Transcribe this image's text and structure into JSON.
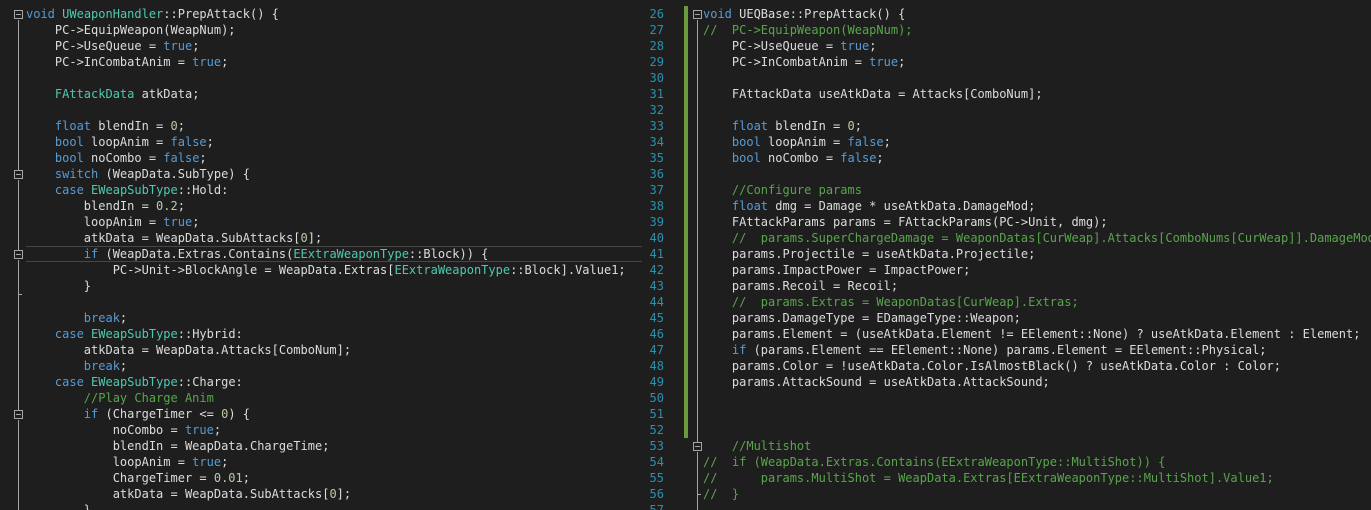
{
  "left_editor": {
    "lines": [
      {
        "segments": [
          {
            "text": "void",
            "cls": "k"
          },
          {
            "text": " "
          },
          {
            "text": "UWeaponHandler",
            "cls": "t"
          },
          {
            "text": "::PrepAttack() {"
          }
        ]
      },
      {
        "segments": [
          {
            "text": "    PC->EquipWeapon(WeapNum);"
          }
        ]
      },
      {
        "segments": [
          {
            "text": "    PC->UseQueue = "
          },
          {
            "text": "true",
            "cls": "k"
          },
          {
            "text": ";"
          }
        ]
      },
      {
        "segments": [
          {
            "text": "    PC->InCombatAnim = "
          },
          {
            "text": "true",
            "cls": "k"
          },
          {
            "text": ";"
          }
        ]
      },
      {
        "segments": []
      },
      {
        "segments": [
          {
            "text": "    "
          },
          {
            "text": "FAttackData",
            "cls": "t"
          },
          {
            "text": " atkData;"
          }
        ]
      },
      {
        "segments": []
      },
      {
        "segments": [
          {
            "text": "    "
          },
          {
            "text": "float",
            "cls": "k"
          },
          {
            "text": " blendIn = "
          },
          {
            "text": "0",
            "cls": "n"
          },
          {
            "text": ";"
          }
        ]
      },
      {
        "segments": [
          {
            "text": "    "
          },
          {
            "text": "bool",
            "cls": "k"
          },
          {
            "text": " loopAnim = "
          },
          {
            "text": "false",
            "cls": "k"
          },
          {
            "text": ";"
          }
        ]
      },
      {
        "segments": [
          {
            "text": "    "
          },
          {
            "text": "bool",
            "cls": "k"
          },
          {
            "text": " noCombo = "
          },
          {
            "text": "false",
            "cls": "k"
          },
          {
            "text": ";"
          }
        ]
      },
      {
        "segments": [
          {
            "text": "    "
          },
          {
            "text": "switch",
            "cls": "k"
          },
          {
            "text": " (WeapData.SubType) {"
          }
        ]
      },
      {
        "segments": [
          {
            "text": "    "
          },
          {
            "text": "case",
            "cls": "k"
          },
          {
            "text": " "
          },
          {
            "text": "EWeapSubType",
            "cls": "t"
          },
          {
            "text": "::Hold:"
          }
        ]
      },
      {
        "segments": [
          {
            "text": "        blendIn = "
          },
          {
            "text": "0.2",
            "cls": "n"
          },
          {
            "text": ";"
          }
        ]
      },
      {
        "segments": [
          {
            "text": "        loopAnim = "
          },
          {
            "text": "true",
            "cls": "k"
          },
          {
            "text": ";"
          }
        ]
      },
      {
        "segments": [
          {
            "text": "        atkData = WeapData.SubAttacks["
          },
          {
            "text": "0",
            "cls": "n"
          },
          {
            "text": "];"
          }
        ]
      },
      {
        "segments": [
          {
            "text": "        "
          },
          {
            "text": "if",
            "cls": "k"
          },
          {
            "text": " (WeapData.Extras.Contains("
          },
          {
            "text": "EExtraWeaponType",
            "cls": "t"
          },
          {
            "text": "::Block)) {"
          }
        ]
      },
      {
        "segments": [
          {
            "text": "            PC->Unit->BlockAngle = WeapData.Extras["
          },
          {
            "text": "EExtraWeaponType",
            "cls": "t"
          },
          {
            "text": "::Block].Value1;"
          }
        ]
      },
      {
        "segments": [
          {
            "text": "        }"
          }
        ]
      },
      {
        "segments": []
      },
      {
        "segments": [
          {
            "text": "        "
          },
          {
            "text": "break",
            "cls": "k"
          },
          {
            "text": ";"
          }
        ]
      },
      {
        "segments": [
          {
            "text": "    "
          },
          {
            "text": "case",
            "cls": "k"
          },
          {
            "text": " "
          },
          {
            "text": "EWeapSubType",
            "cls": "t"
          },
          {
            "text": "::Hybrid:"
          }
        ]
      },
      {
        "segments": [
          {
            "text": "        atkData = WeapData.Attacks[ComboNum];"
          }
        ]
      },
      {
        "segments": [
          {
            "text": "        "
          },
          {
            "text": "break",
            "cls": "k"
          },
          {
            "text": ";"
          }
        ]
      },
      {
        "segments": [
          {
            "text": "    "
          },
          {
            "text": "case",
            "cls": "k"
          },
          {
            "text": " "
          },
          {
            "text": "EWeapSubType",
            "cls": "t"
          },
          {
            "text": "::Charge:"
          }
        ]
      },
      {
        "segments": [
          {
            "text": "        "
          },
          {
            "text": "//Play Charge Anim",
            "cls": "c"
          }
        ]
      },
      {
        "segments": [
          {
            "text": "        "
          },
          {
            "text": "if",
            "cls": "k"
          },
          {
            "text": " (ChargeTimer <= "
          },
          {
            "text": "0",
            "cls": "n"
          },
          {
            "text": ") {"
          }
        ]
      },
      {
        "segments": [
          {
            "text": "            noCombo = "
          },
          {
            "text": "true",
            "cls": "k"
          },
          {
            "text": ";"
          }
        ]
      },
      {
        "segments": [
          {
            "text": "            blendIn = WeapData.ChargeTime;"
          }
        ]
      },
      {
        "segments": [
          {
            "text": "            loopAnim = "
          },
          {
            "text": "true",
            "cls": "k"
          },
          {
            "text": ";"
          }
        ]
      },
      {
        "segments": [
          {
            "text": "            ChargeTimer = "
          },
          {
            "text": "0.01",
            "cls": "n"
          },
          {
            "text": ";"
          }
        ]
      },
      {
        "segments": [
          {
            "text": "            atkData = WeapData.SubAttacks["
          },
          {
            "text": "0",
            "cls": "n"
          },
          {
            "text": "];"
          }
        ]
      },
      {
        "segments": [
          {
            "text": "        }"
          }
        ]
      }
    ]
  },
  "right_editor": {
    "line_numbers": [
      "26",
      "27",
      "28",
      "29",
      "30",
      "31",
      "32",
      "33",
      "34",
      "35",
      "36",
      "37",
      "38",
      "39",
      "40",
      "41",
      "42",
      "43",
      "44",
      "45",
      "46",
      "47",
      "48",
      "49",
      "50",
      "51",
      "52",
      "53",
      "54",
      "55",
      "56",
      "57"
    ],
    "lines": [
      {
        "segments": [
          {
            "text": "void",
            "cls": "k"
          },
          {
            "text": " UEQBase::PrepAttack() {"
          }
        ]
      },
      {
        "segments": [
          {
            "text": "//  PC->EquipWeapon(WeapNum);",
            "cls": "c"
          }
        ]
      },
      {
        "segments": [
          {
            "text": "    PC->UseQueue = "
          },
          {
            "text": "true",
            "cls": "k"
          },
          {
            "text": ";"
          }
        ]
      },
      {
        "segments": [
          {
            "text": "    PC->InCombatAnim = "
          },
          {
            "text": "true",
            "cls": "k"
          },
          {
            "text": ";"
          }
        ]
      },
      {
        "segments": []
      },
      {
        "segments": [
          {
            "text": "    FAttackData useAtkData = Attacks[ComboNum];"
          }
        ]
      },
      {
        "segments": []
      },
      {
        "segments": [
          {
            "text": "    "
          },
          {
            "text": "float",
            "cls": "k"
          },
          {
            "text": " blendIn = "
          },
          {
            "text": "0",
            "cls": "n"
          },
          {
            "text": ";"
          }
        ]
      },
      {
        "segments": [
          {
            "text": "    "
          },
          {
            "text": "bool",
            "cls": "k"
          },
          {
            "text": " loopAnim = "
          },
          {
            "text": "false",
            "cls": "k"
          },
          {
            "text": ";"
          }
        ]
      },
      {
        "segments": [
          {
            "text": "    "
          },
          {
            "text": "bool",
            "cls": "k"
          },
          {
            "text": " noCombo = "
          },
          {
            "text": "false",
            "cls": "k"
          },
          {
            "text": ";"
          }
        ]
      },
      {
        "segments": []
      },
      {
        "segments": [
          {
            "text": "    "
          },
          {
            "text": "//Configure params",
            "cls": "c"
          }
        ]
      },
      {
        "segments": [
          {
            "text": "    "
          },
          {
            "text": "float",
            "cls": "k"
          },
          {
            "text": " dmg = Damage * useAtkData.DamageMod;"
          }
        ]
      },
      {
        "segments": [
          {
            "text": "    FAttackParams params = FAttackParams(PC->Unit, dmg);"
          }
        ]
      },
      {
        "segments": [
          {
            "text": "    "
          },
          {
            "text": "//  params.SuperChargeDamage = WeaponDatas[CurWeap].Attacks[ComboNums[CurWeap]].DamageMod *",
            "cls": "c"
          }
        ]
      },
      {
        "segments": [
          {
            "text": "    params.Projectile = useAtkData.Projectile;"
          }
        ]
      },
      {
        "segments": [
          {
            "text": "    params.ImpactPower = ImpactPower;"
          }
        ]
      },
      {
        "segments": [
          {
            "text": "    params.Recoil = Recoil;"
          }
        ]
      },
      {
        "segments": [
          {
            "text": "    "
          },
          {
            "text": "//  params.Extras = WeaponDatas[CurWeap].Extras;",
            "cls": "c"
          }
        ]
      },
      {
        "segments": [
          {
            "text": "    params.DamageType = EDamageType::Weapon;"
          }
        ]
      },
      {
        "segments": [
          {
            "text": "    params.Element = (useAtkData.Element != EElement::None) ? useAtkData.Element : Element;"
          }
        ]
      },
      {
        "segments": [
          {
            "text": "    "
          },
          {
            "text": "if",
            "cls": "k"
          },
          {
            "text": " (params.Element == EElement::None) params.Element = EElement::Physical;"
          }
        ]
      },
      {
        "segments": [
          {
            "text": "    params.Color = !useAtkData.Color.IsAlmostBlack() ? useAtkData.Color : Color;"
          }
        ]
      },
      {
        "segments": [
          {
            "text": "    params.AttackSound = useAtkData.AttackSound;"
          }
        ]
      },
      {
        "segments": []
      },
      {
        "segments": []
      },
      {
        "segments": []
      },
      {
        "segments": [
          {
            "text": "    "
          },
          {
            "text": "//Multishot",
            "cls": "c"
          }
        ]
      },
      {
        "segments": [
          {
            "text": "//  if (WeapData.Extras.Contains(EExtraWeaponType::MultiShot)) {",
            "cls": "c"
          }
        ]
      },
      {
        "segments": [
          {
            "text": "//      params.MultiShot = WeapData.Extras[EExtraWeaponType::MultiShot].Value1;",
            "cls": "c"
          }
        ]
      },
      {
        "segments": [
          {
            "text": "//  }",
            "cls": "c"
          }
        ]
      },
      {
        "segments": []
      }
    ]
  }
}
